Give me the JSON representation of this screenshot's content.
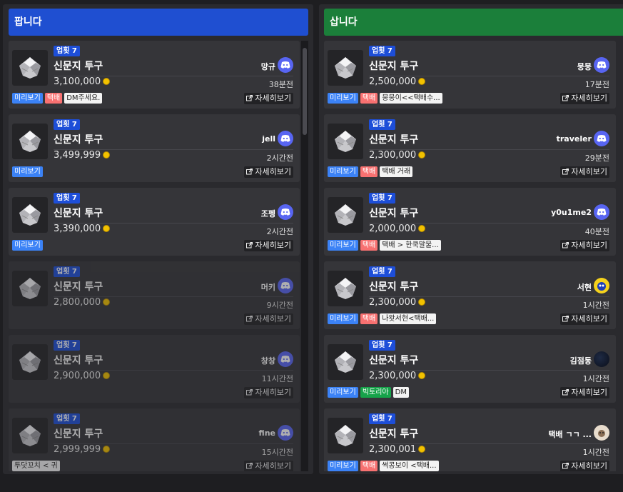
{
  "columns": {
    "sell": {
      "title": "팝니다"
    },
    "buy": {
      "title": "삽니다"
    }
  },
  "detail_label": "자세히보기",
  "sell_items": [
    {
      "level": "업횟 7",
      "name": "신문지 투구",
      "user": "망규",
      "price": "3,100,000",
      "time": "38분전",
      "tags": [
        "미리보기",
        "택배"
      ],
      "note": "DM주세요.",
      "dim": false,
      "avatar": "discord-icon"
    },
    {
      "level": "업횟 7",
      "name": "신문지 투구",
      "user": "jell",
      "price": "3,499,999",
      "time": "2시간전",
      "tags": [
        "미리보기"
      ],
      "note": "",
      "dim": false,
      "avatar": "discord-icon"
    },
    {
      "level": "업횟 7",
      "name": "신문지 투구",
      "user": "조펭",
      "price": "3,390,000",
      "time": "2시간전",
      "tags": [
        "미리보기"
      ],
      "note": "",
      "dim": false,
      "avatar": "discord-icon"
    },
    {
      "level": "업횟 7",
      "name": "신문지 투구",
      "user": "머키",
      "price": "2,800,000",
      "time": "9시간전",
      "tags": [],
      "note": "",
      "dim": true,
      "avatar": "discord-icon"
    },
    {
      "level": "업횟 7",
      "name": "신문지 투구",
      "user": "창창",
      "price": "2,900,000",
      "time": "11시간전",
      "tags": [],
      "note": "",
      "dim": true,
      "avatar": "discord-icon"
    },
    {
      "level": "업횟 7",
      "name": "신문지 투구",
      "user": "fine",
      "price": "2,999,999",
      "time": "15시간전",
      "tags": [],
      "note": "투닷꼬치 < 귀",
      "dim": true,
      "avatar": "discord-icon"
    }
  ],
  "buy_items": [
    {
      "level": "업횟 7",
      "name": "신문지 투구",
      "user": "뭉뭉",
      "price": "2,500,000",
      "time": "17분전",
      "tags": [
        "미리보기",
        "택배"
      ],
      "note": "뭉뭉이<<택배수...",
      "avatar": "discord-icon"
    },
    {
      "level": "업횟 7",
      "name": "신문지 투구",
      "user": "traveler",
      "price": "2,300,000",
      "time": "29분전",
      "tags": [
        "미리보기",
        "택배"
      ],
      "note": "택배 거래",
      "avatar": "discord-icon"
    },
    {
      "level": "업횟 7",
      "name": "신문지 투구",
      "user": "y0u1me2",
      "price": "2,000,000",
      "time": "40분전",
      "tags": [
        "미리보기",
        "택배"
      ],
      "note": "택배 > 한쿡말물...",
      "avatar": "discord-icon"
    },
    {
      "level": "업횟 7",
      "name": "신문지 투구",
      "user": "서현",
      "price": "2,300,000",
      "time": "1시간전",
      "tags": [
        "미리보기",
        "택배"
      ],
      "note": "나왓서현<택배...",
      "avatar": "sonic-avatar"
    },
    {
      "level": "업횟 7",
      "name": "신문지 투구",
      "user": "김점동",
      "price": "2,300,000",
      "time": "1시간전",
      "tags": [
        "미리보기",
        "빅토리아"
      ],
      "note": "DM",
      "avatar": "dark-avatar"
    },
    {
      "level": "업횟 7",
      "name": "신문지 투구",
      "user": "택배 ㄱㄱ ...",
      "price": "2,300,001",
      "time": "1시간전",
      "tags": [
        "미리보기",
        "택배"
      ],
      "note": "썩콩보이 <택배...",
      "avatar": "cat-avatar"
    }
  ],
  "colors": {
    "sell_header": "#1f4fd1",
    "buy_header": "#1b7f3a",
    "preview_tag": "#3b82f6",
    "delivery_tag": "#f87171",
    "victoria_tag": "#16a34a",
    "discord": "#5865f2"
  }
}
